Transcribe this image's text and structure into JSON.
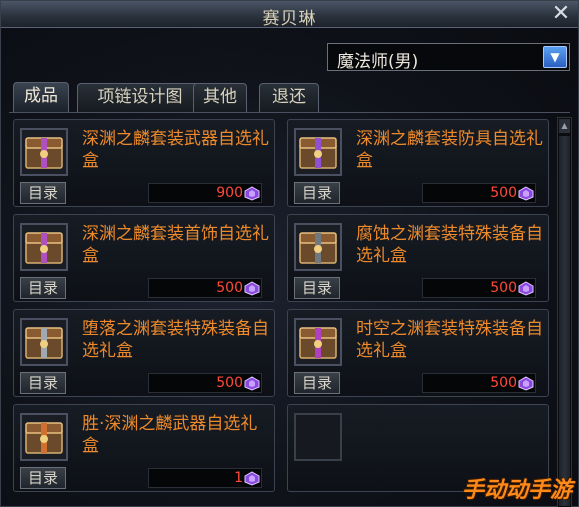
{
  "window": {
    "title": "赛贝琳",
    "close_icon": "close-icon"
  },
  "class_select": {
    "value": "魔法师(男)"
  },
  "tabs": [
    {
      "label": "成品",
      "active": true
    },
    {
      "label": "项链设计图",
      "active": false
    },
    {
      "label": "其他",
      "active": false
    },
    {
      "label": "退还",
      "active": false
    }
  ],
  "catalog_label": "目录",
  "items": [
    {
      "name": "深渊之麟套装武器自选礼盒",
      "price": "900",
      "icon": "treasure-box-icon"
    },
    {
      "name": "深渊之麟套装防具自选礼盒",
      "price": "500",
      "icon": "treasure-box-icon"
    },
    {
      "name": "深渊之麟套装首饰自选礼盒",
      "price": "500",
      "icon": "treasure-box-icon"
    },
    {
      "name": "腐蚀之渊套装特殊装备自选礼盒",
      "price": "500",
      "icon": "treasure-box-icon"
    },
    {
      "name": "堕落之渊套装特殊装备自选礼盒",
      "price": "500",
      "icon": "treasure-box-icon"
    },
    {
      "name": "时空之渊套装特殊装备自选礼盒",
      "price": "500",
      "icon": "treasure-box-icon"
    },
    {
      "name": "胜·深渊之麟武器自选礼盒",
      "price": "1",
      "icon": "treasure-box-icon"
    }
  ],
  "watermark": "手动动手游",
  "colors": {
    "item_name": "#ee8a2a",
    "price": "#ff4a3a",
    "accent": "#2b5fc0"
  }
}
